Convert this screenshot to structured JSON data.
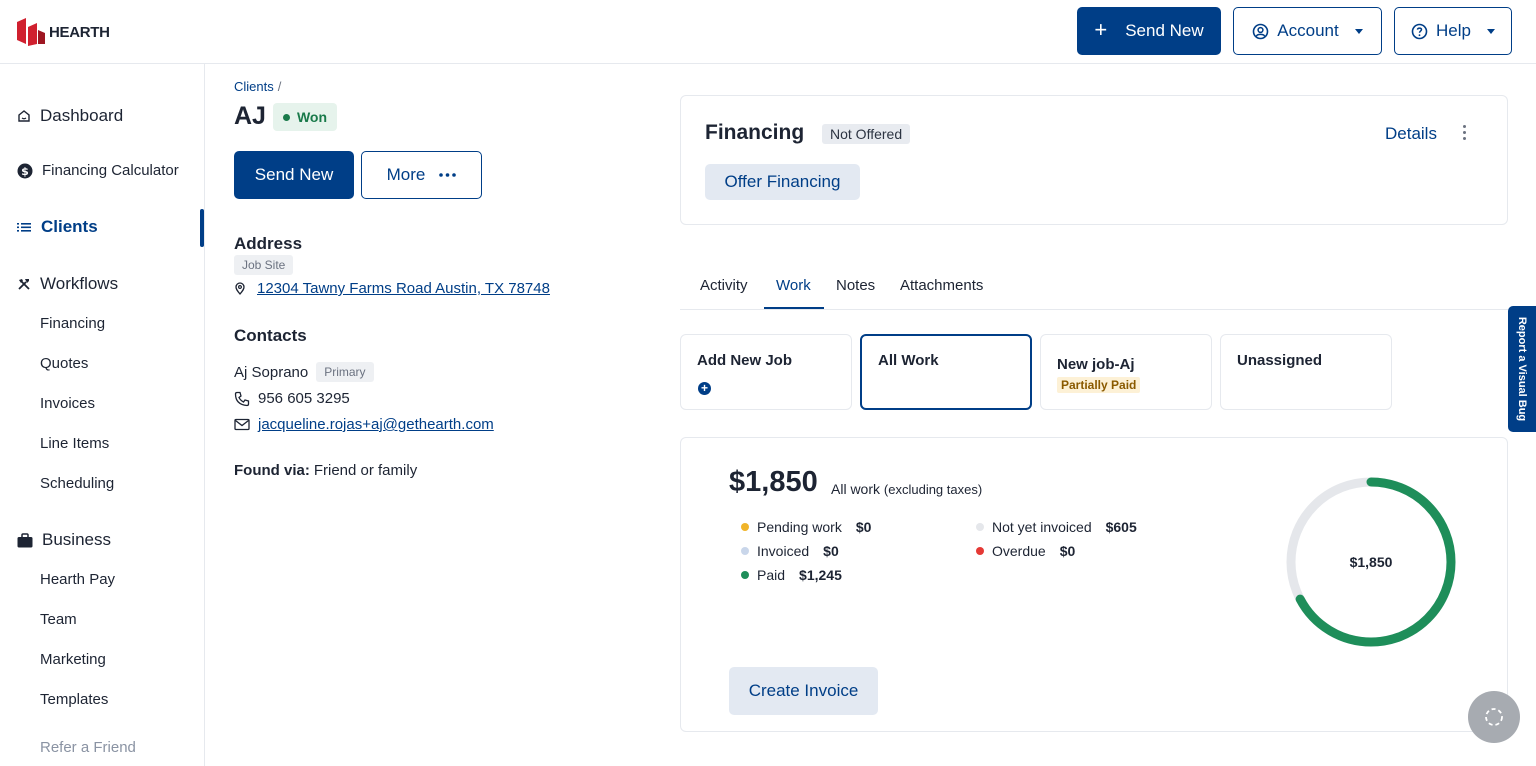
{
  "brand": {
    "name": "HEARTH",
    "logo_color": "#d0202f"
  },
  "header": {
    "send_new": "Send New",
    "account": "Account",
    "help": "Help"
  },
  "sidebar": {
    "dashboard": "Dashboard",
    "financing_calculator": "Financing Calculator",
    "clients": "Clients",
    "workflows": "Workflows",
    "workflow_items": [
      "Financing",
      "Quotes",
      "Invoices",
      "Line Items",
      "Scheduling"
    ],
    "business": "Business",
    "business_items": [
      "Hearth Pay",
      "Team",
      "Marketing",
      "Templates"
    ],
    "refer": "Refer a Friend"
  },
  "client": {
    "breadcrumb": "Clients",
    "breadcrumb_sep": "/",
    "name": "AJ",
    "status": "Won",
    "send_new": "Send New",
    "more": "More",
    "address_title": "Address",
    "address_tag": "Job Site",
    "address": "12304 Tawny Farms Road Austin, TX 78748",
    "contacts_title": "Contacts",
    "contact_name": "Aj Soprano",
    "contact_tag": "Primary",
    "phone": "956 605 3295",
    "email": "jacqueline.rojas+aj@gethearth.com",
    "found_via_label": "Found via:",
    "found_via": "Friend or family"
  },
  "financing": {
    "title": "Financing",
    "status": "Not Offered",
    "details": "Details",
    "offer_button": "Offer Financing"
  },
  "tabs": [
    "Activity",
    "Work",
    "Notes",
    "Attachments"
  ],
  "active_tab": "Work",
  "job_cards": {
    "add_new": "Add New Job",
    "all_work": "All Work",
    "job_name": "New job-Aj",
    "job_status": "Partially Paid",
    "unassigned": "Unassigned"
  },
  "summary": {
    "total": "$1,850",
    "label": "All work",
    "label_note": "(excluding taxes)",
    "legend": [
      {
        "label": "Pending work",
        "value": "$0",
        "color": "#f0b429"
      },
      {
        "label": "Invoiced",
        "value": "$0",
        "color": "#c9d6ea"
      },
      {
        "label": "Paid",
        "value": "$1,245",
        "color": "#1e8e5a"
      },
      {
        "label": "Not yet invoiced",
        "value": "$605",
        "color": "#e5e7eb"
      },
      {
        "label": "Overdue",
        "value": "$0",
        "color": "#e53935"
      }
    ],
    "donut_center": "$1,850",
    "paid_fraction": 0.673,
    "create_invoice": "Create Invoice"
  },
  "report_bug": "Report a Visual Bug",
  "colors": {
    "primary": "#003e87",
    "success": "#197a4a"
  }
}
